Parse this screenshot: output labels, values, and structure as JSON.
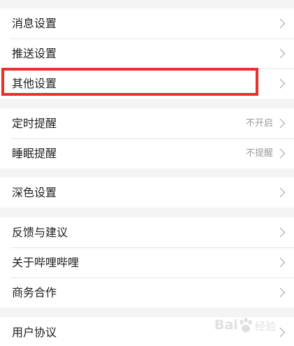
{
  "settings": {
    "group1": [
      {
        "label": "消息设置",
        "value": ""
      },
      {
        "label": "推送设置",
        "value": ""
      },
      {
        "label": "其他设置",
        "value": ""
      }
    ],
    "group2": [
      {
        "label": "定时提醒",
        "value": "不开启"
      },
      {
        "label": "睡眠提醒",
        "value": "不提醒"
      }
    ],
    "group3": [
      {
        "label": "深色设置",
        "value": ""
      }
    ],
    "group4": [
      {
        "label": "反馈与建议",
        "value": ""
      },
      {
        "label": "关于哔哩哔哩",
        "value": ""
      },
      {
        "label": "商务合作",
        "value": ""
      }
    ],
    "group5": [
      {
        "label": "用户协议",
        "value": ""
      }
    ]
  },
  "annotation": {
    "highlighted_item": "其他设置",
    "color": "#e8302d"
  },
  "watermark": {
    "brand": "Bai",
    "text": "经验"
  },
  "colors": {
    "background": "#f4f4f4",
    "row_background": "#ffffff",
    "text": "#1f1f1f",
    "secondary_text": "#9a9a9a"
  }
}
